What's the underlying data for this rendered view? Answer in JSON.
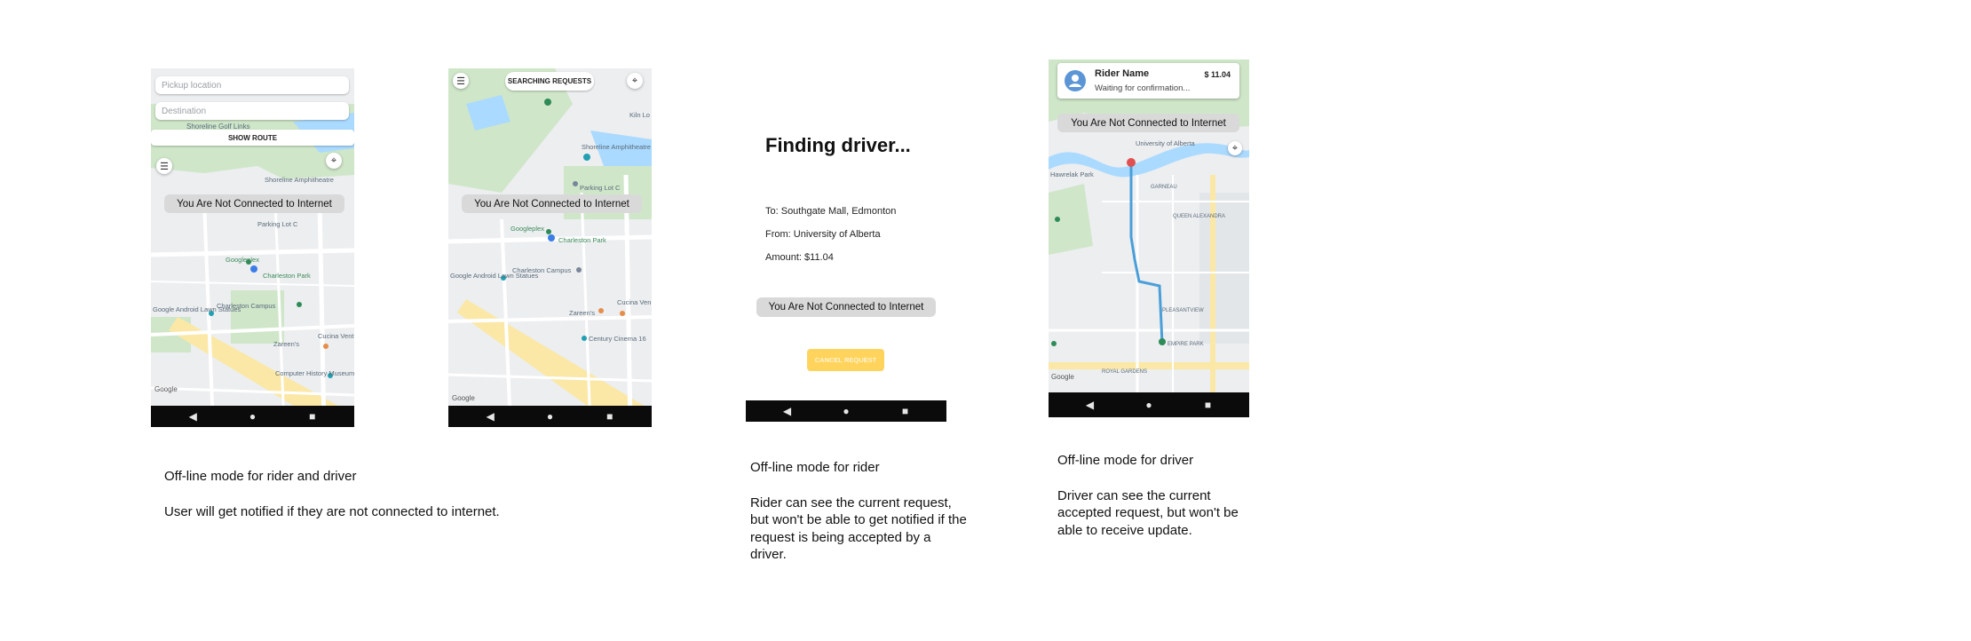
{
  "offline_banner": "You Are Not Connected to Internet",
  "nav_icons": [
    "back-triangle",
    "home-circle",
    "recents-square"
  ],
  "nav_glyphs": {
    "back": "◀",
    "home": "●",
    "recents": "■"
  },
  "screen1": {
    "pickup_placeholder": "Pickup location",
    "destination_placeholder": "Destination",
    "partial_map_text": "Shoreline Golf Links",
    "show_route": "SHOW ROUTE",
    "menu_glyph": "☰",
    "locate_glyph": "⌖",
    "map_labels": [
      "Shoreline Amphitheatre",
      "Parking Lot C",
      "Googleplex",
      "Charleston Park",
      "Google Android Lawn Statues",
      "Charleston Campus",
      "Cucina Venti",
      "Zareen's",
      "Computer History Museum"
    ],
    "google": "Google"
  },
  "screen2": {
    "searching": "SEARCHING REQUESTS",
    "menu_glyph": "☰",
    "locate_glyph": "⌖",
    "map_labels": [
      "Kiln Lo",
      "Shoreline Amphitheatre",
      "Parking Lot C",
      "Googleplex",
      "Charleston Park",
      "Google Android Lawn Statues",
      "Charleston Campus",
      "Zareen's",
      "Cucina Ven",
      "Century Cinema 16"
    ],
    "google": "Google"
  },
  "screen3": {
    "title": "Finding driver...",
    "to": "To: Southgate Mall, Edmonton",
    "from": "From: University of Alberta",
    "amount": "Amount: $11.04",
    "cancel": "CANCEL REQUEST"
  },
  "screen4": {
    "rider_name": "Rider Name",
    "status": "Waiting for confirmation...",
    "price": "$ 11.04",
    "locate_glyph": "⌖",
    "map_labels": [
      "University of Alberta",
      "Hawrelak Park",
      "GARNEAU",
      "QUEEN ALEXANDRA",
      "PLEASANTVIEW",
      "EMPIRE PARK",
      "ROYAL GARDENS"
    ],
    "google": "Google"
  },
  "captions": {
    "c1_title": "Off-line mode for rider and driver",
    "c1_body": "User will get notified if they are not connected to internet.",
    "c2_title": "Off-line mode for rider",
    "c2_body": "Rider can see the current request, but won't be able to get notified if the request is being accepted by a driver.",
    "c3_title": "Off-line mode for driver",
    "c3_body": "Driver can see the current accepted request, but won't be able to receive update."
  },
  "colors": {
    "park": "#cfe6c9",
    "road_major": "#fbe8a6",
    "water": "#aadaff",
    "route": "#4a9fd8",
    "accent_button": "#ffd35c",
    "banner": "#d9d9d9"
  }
}
